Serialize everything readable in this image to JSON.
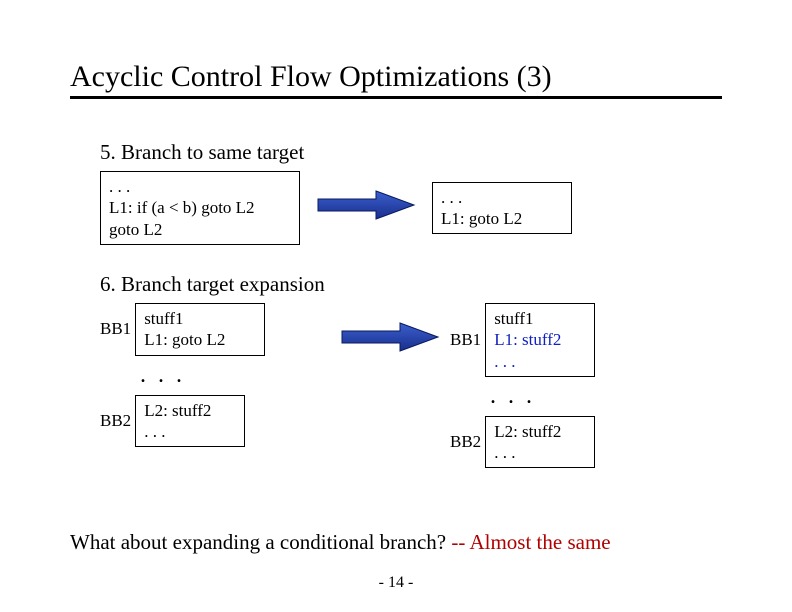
{
  "title": "Acyclic Control Flow Optimizations (3)",
  "section5": {
    "heading": "5. Branch to same target",
    "left_code": ". . .\nL1: if (a < b) goto L2\ngoto L2",
    "right_code": ". . .\nL1: goto L2"
  },
  "section6": {
    "heading": "6. Branch target expansion",
    "left_bb1_label": "BB1",
    "left_bb1_code": "stuff1\nL1: goto L2",
    "left_bb2_label": "BB2",
    "left_bb2_code": "L2: stuff2\n. . .",
    "right_bb1_label": "BB1",
    "right_bb1_line1": "stuff1",
    "right_bb1_line2": "L1: stuff2",
    "right_bb1_line3": ". . .",
    "right_bb2_label": "BB2",
    "right_bb2_code": "L2: stuff2\n. . .",
    "ellipsis": ". . ."
  },
  "bottom_note_black": "What about expanding a conditional branch?  ",
  "bottom_note_red": "-- Almost the same",
  "page_number": "- 14 -"
}
